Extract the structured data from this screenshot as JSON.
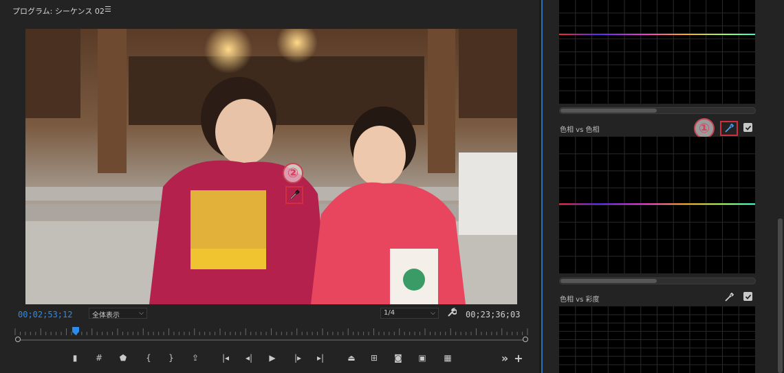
{
  "program_monitor": {
    "title": "プログラム: シーケンス 02",
    "menu_icon": "hamburger-menu-icon",
    "current_timecode": "00;02;53;12",
    "duration_timecode": "00;23;36;03",
    "zoom_select": "全体表示",
    "resolution_select": "1/4",
    "settings_icon": "wrench-icon"
  },
  "transport": {
    "buttons": [
      {
        "name": "add-marker-button",
        "icon": "marker-icon"
      },
      {
        "name": "add-grid-button",
        "icon": "grid-icon"
      },
      {
        "name": "marker-button",
        "icon": "marker-shield-icon"
      },
      {
        "name": "mark-in-button",
        "icon": "mark-in-icon"
      },
      {
        "name": "mark-out-button",
        "icon": "mark-out-icon"
      },
      {
        "name": "export-button",
        "icon": "export-icon"
      },
      {
        "name": "go-to-in-button",
        "icon": "go-to-in-icon"
      },
      {
        "name": "step-back-button",
        "icon": "step-back-icon"
      },
      {
        "name": "play-button",
        "icon": "play-icon"
      },
      {
        "name": "step-forward-button",
        "icon": "step-forward-icon"
      },
      {
        "name": "go-to-out-button",
        "icon": "go-to-out-icon"
      },
      {
        "name": "lift-button",
        "icon": "lift-icon"
      },
      {
        "name": "extract-button",
        "icon": "extract-icon"
      },
      {
        "name": "export-frame-button",
        "icon": "camera-icon"
      },
      {
        "name": "comparison-view-button",
        "icon": "comparison-icon"
      },
      {
        "name": "multicam-button",
        "icon": "multicam-icon"
      },
      {
        "name": "more-button",
        "icon": "double-chevron-icon"
      },
      {
        "name": "add-button",
        "icon": "plus-icon"
      }
    ]
  },
  "scopes": {
    "hue_vs_hue_label": "色相 vs 色相",
    "hue_vs_sat_label": "色相 vs 彩度",
    "eyedropper_icon": "eyedropper-icon",
    "checkbox_icon": "checkbox-checked-icon"
  },
  "annotations": {
    "step1": "①",
    "step2": "②",
    "highlight_color": "#d12f3e"
  },
  "colors": {
    "accent_blue": "#2d8ceb",
    "panel_bg": "#232323",
    "scope_bg": "#000000"
  }
}
